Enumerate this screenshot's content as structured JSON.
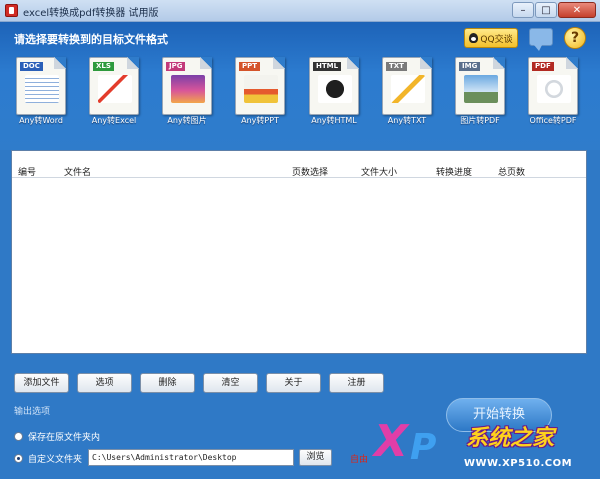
{
  "window": {
    "title": "excel转换成pdf转换器 试用版",
    "minimize": "–",
    "maximize": "□",
    "close": "✕"
  },
  "header": {
    "prompt": "请选择要转换到的目标文件格式",
    "qq_button": "QQ交谈",
    "help": "?"
  },
  "formats": [
    {
      "tag": "DOC",
      "label": "Any转Word",
      "tag_color": "#2a5fb8"
    },
    {
      "tag": "XLS",
      "label": "Any转Excel",
      "tag_color": "#2e9a3d"
    },
    {
      "tag": "JPG",
      "label": "Any转图片",
      "tag_color": "#c23a7a"
    },
    {
      "tag": "PPT",
      "label": "Any转PPT",
      "tag_color": "#d4542a"
    },
    {
      "tag": "HTML",
      "label": "Any转HTML",
      "tag_color": "#333333"
    },
    {
      "tag": "TXT",
      "label": "Any转TXT",
      "tag_color": "#7a7a7a"
    },
    {
      "tag": "IMG",
      "label": "图片转PDF",
      "tag_color": "#5a6f8c"
    },
    {
      "tag": "PDF",
      "label": "Office转PDF",
      "tag_color": "#b22a22"
    }
  ],
  "table": {
    "columns": [
      "编号",
      "文件名",
      "页数选择",
      "文件大小",
      "转换进度",
      "总页数"
    ],
    "rows": []
  },
  "actions": {
    "add": "添加文件",
    "clear_list": "清空",
    "remove": "删除",
    "empty": "清空",
    "about": "关于",
    "register": "注册",
    "first": "添加文件",
    "second": "选项"
  },
  "output": {
    "label": "输出选项",
    "opt1": "保存在原文件夹内",
    "opt2": "自定义文件夹",
    "path": "C:\\Users\\Administrator\\Desktop",
    "browse": "浏览",
    "hint": "自由",
    "start": "开始转换"
  },
  "watermark": {
    "x": "X",
    "p": "P",
    "brand": "系统之家",
    "url": "WWW.XP510.COM"
  }
}
